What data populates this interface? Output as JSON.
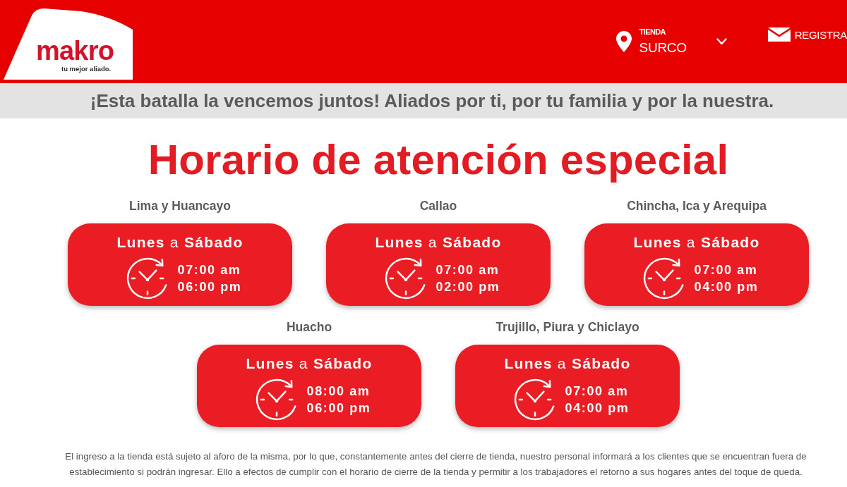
{
  "header": {
    "logo": {
      "wordmark": "makro",
      "tagline": "tu mejor aliado."
    },
    "store": {
      "label": "TIENDA",
      "value": "SURCO"
    },
    "register": "REGISTRA"
  },
  "banner": "¡Esta batalla la vencemos juntos! Aliados por ti, por tu familia y por la nuestra.",
  "title": "Horario de atención especial",
  "schedule_rows": [
    {
      "locations": [
        {
          "name": "Lima y Huancayo",
          "days": "**Lunes** a **Sábado**",
          "open": "07:00 am",
          "close": "06:00 pm"
        },
        {
          "name": "Callao",
          "days": "**Lunes** a **Sábado**",
          "open": "07:00 am",
          "close": "02:00 pm"
        },
        {
          "name": "Chincha, Ica y Arequipa",
          "days": "**Lunes** a **Sábado**",
          "open": "07:00 am",
          "close": "04:00 pm"
        }
      ]
    },
    {
      "locations": [
        {
          "name": "Huacho",
          "days": "**Lunes** a **Sábado**",
          "open": "08:00 am",
          "close": "06:00 pm"
        },
        {
          "name": "Trujillo, Piura y Chiclayo",
          "days": "**Lunes** a **Sábado**",
          "open": "07:00 am",
          "close": "04:00 pm"
        }
      ]
    }
  ],
  "footer_note": "El ingreso a la tienda está sujeto al aforo de la misma, por lo que, constantemente antes del cierre de tienda, nuestro personal informará a los clientes que se encuentran fuera de establecimiento si podrán ingresar. Ello a efectos de cumplir con el horario de cierre de la tienda y permitir a los trabajadores el retorno a sus hogares antes del toque de queda."
}
